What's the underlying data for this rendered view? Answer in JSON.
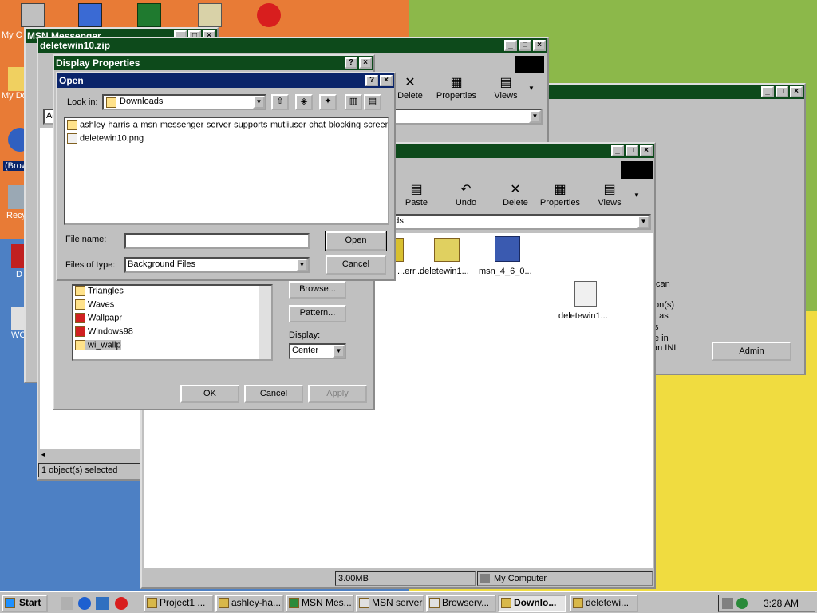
{
  "colors": {
    "accent": "#0a246a",
    "deskOrange": "#e87b36",
    "deskGreen": "#8cb84a",
    "deskBlue": "#4d80c4",
    "deskYellow": "#f0dc40"
  },
  "desktop": {
    "icons": [
      {
        "label": "My C",
        "icon": "my-computer-icon"
      },
      {
        "label": "My Do",
        "icon": "my-documents-icon"
      },
      {
        "label": "(Brow",
        "icon": "browser-icon"
      },
      {
        "label": "Recy",
        "icon": "recycle-bin-icon"
      },
      {
        "label": "D",
        "icon": "shortcut-icon"
      },
      {
        "label": "WO",
        "icon": "shortcut-icon"
      }
    ]
  },
  "windows": {
    "msn_messenger": {
      "title": "MSN Messenger"
    },
    "deletewin_zip": {
      "title": "deletewin10.zip",
      "toolbar": [
        "Delete",
        "Properties",
        "Views"
      ],
      "status": "1 object(s) selected",
      "address_stub": "Ad"
    },
    "back_dialog": {
      "text_lines": [
        "can",
        "on(s)",
        ", as",
        "s",
        "e in",
        "an INI"
      ],
      "admin_button": "Admin"
    },
    "downloads": {
      "toolbar": [
        "Paste",
        "Undo",
        "Delete",
        "Properties",
        "Views"
      ],
      "address": "oads",
      "files": [
        {
          "name": "...err...",
          "icon": "folder-icon"
        },
        {
          "name": "deletewin1...",
          "icon": "zip-icon"
        },
        {
          "name": "msn_4_6_0...",
          "icon": "installer-icon"
        },
        {
          "name": "deletewin1...",
          "icon": "image-file-icon"
        }
      ],
      "status_size": "3.00MB",
      "status_zone": "My Computer"
    },
    "display_properties": {
      "title": "Display Properties",
      "wallpapers": [
        "Triangles",
        "Waves",
        "Wallpapr",
        "Windows98",
        "wi_wallp"
      ],
      "browse": "Browse...",
      "pattern": "Pattern...",
      "display_label": "Display:",
      "display_value": "Center",
      "ok": "OK",
      "cancel": "Cancel",
      "apply": "Apply"
    },
    "open_dialog": {
      "title": "Open",
      "look_in_label": "Look in:",
      "look_in_value": "Downloads",
      "files": [
        {
          "name": "ashley-harris-a-msn-messenger-server-supports-mutliuser-chat-blocking-screen-",
          "icon": "folder-icon"
        },
        {
          "name": "deletewin10.png",
          "icon": "image-file-icon"
        }
      ],
      "file_name_label": "File name:",
      "file_name_value": "",
      "files_of_type_label": "Files of type:",
      "files_of_type_value": "Background Files",
      "open": "Open",
      "cancel": "Cancel"
    }
  },
  "taskbar": {
    "start": "Start",
    "tasks": [
      "Project1 ...",
      "ashley-ha...",
      "MSN Mes...",
      "MSN server",
      "Browserv...",
      "Downlo...",
      "deletewi..."
    ],
    "clock": "3:28 AM"
  }
}
